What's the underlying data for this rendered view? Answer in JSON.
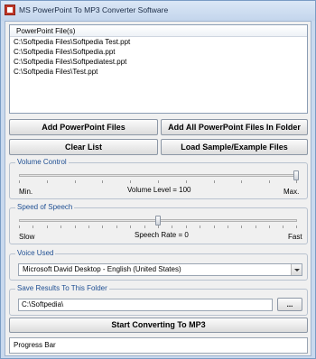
{
  "window": {
    "title": "MS PowerPoint To MP3 Converter Software"
  },
  "file_list": {
    "column_header": "PowerPoint File(s)",
    "items": [
      "C:\\Softpedia Files\\Softpedia Test.ppt",
      "C:\\Softpedia Files\\Softpedia.ppt",
      "C:\\Softpedia Files\\Softpediatest.ppt",
      "C:\\Softpedia Files\\Test.ppt"
    ]
  },
  "buttons": {
    "add_files": "Add PowerPoint Files",
    "add_folder": "Add All PowerPoint Files In Folder",
    "clear_list": "Clear List",
    "load_sample": "Load Sample/Example Files",
    "browse": "...",
    "start": "Start Converting To MP3"
  },
  "volume": {
    "title": "Volume Control",
    "min_label": "Min.",
    "max_label": "Max.",
    "value_label": "Volume Level = 100",
    "level": 100
  },
  "speech": {
    "title": "Speed of Speech",
    "slow_label": "Slow",
    "fast_label": "Fast",
    "value_label": "Speech Rate = 0",
    "rate": 0
  },
  "voice": {
    "title": "Voice Used",
    "selected": "Microsoft David Desktop - English (United States)"
  },
  "save": {
    "title": "Save Results To This Folder",
    "path": "C:\\Softpedia\\"
  },
  "status": {
    "progress_label": "Progress Bar"
  }
}
